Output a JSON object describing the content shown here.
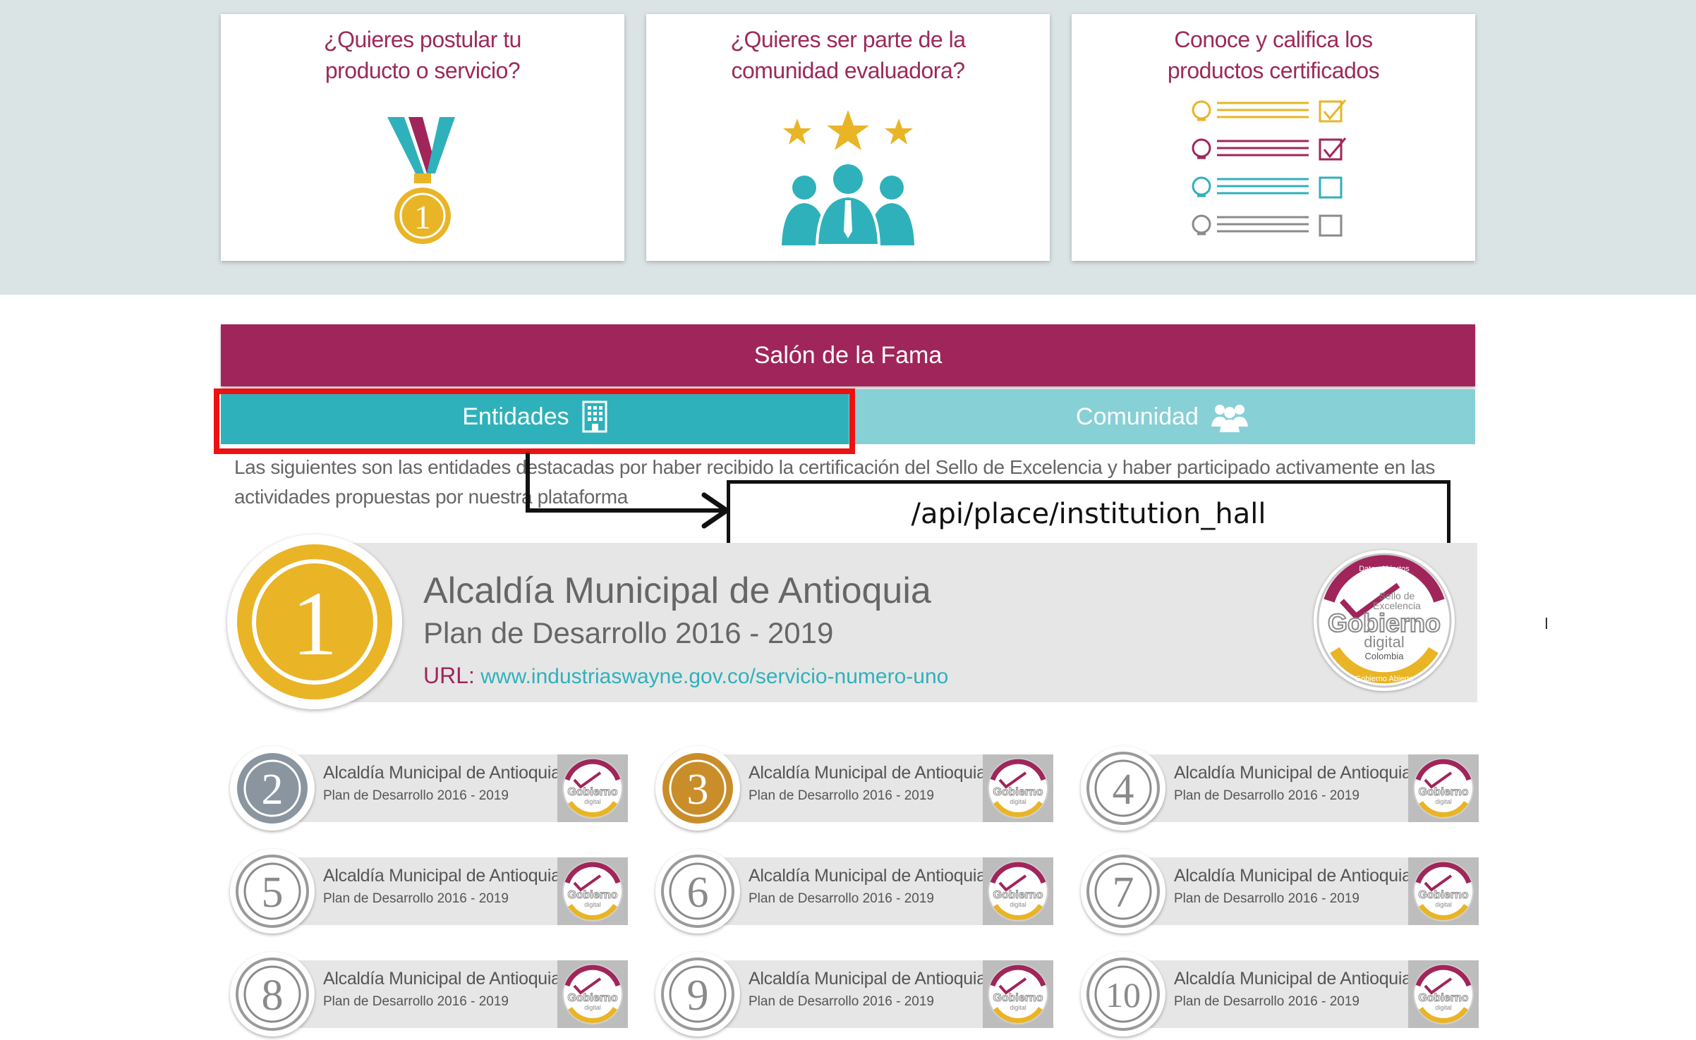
{
  "promo_cards": [
    {
      "title": "¿Quieres postular tu\nproducto o servicio?",
      "icon": "medal-icon"
    },
    {
      "title": "¿Quieres ser parte de la\ncomunidad evaluadora?",
      "icon": "community-stars-icon"
    },
    {
      "title": "Conoce y califica los\nproductos certificados",
      "icon": "checklist-icon"
    }
  ],
  "hall": {
    "title": "Salón de la Fama",
    "tabs": [
      {
        "label": "Entidades",
        "icon": "building-icon",
        "active": true
      },
      {
        "label": "Comunidad",
        "icon": "group-icon",
        "active": false
      }
    ],
    "intro": "Las siguientes son las entidades destacadas por haber recibido la certificación del Sello de Excelencia y haber participado activamente en las actividades propuestas por nuestra plataforma"
  },
  "annotation": {
    "endpoint": "/api/place/institution_hall"
  },
  "winner": {
    "rank": "1",
    "name": "Alcaldía Municipal de Antioquia",
    "plan": "Plan de Desarrollo 2016 - 2019",
    "url_label": "URL:",
    "url": "www.industriaswayne.gov.co/servicio-numero-uno",
    "seal": {
      "top": "Datos Abiertos",
      "line1": "Sello de",
      "line2": "Excelencia",
      "brand": "Gobierno",
      "sub": "digital",
      "country": "Colombia",
      "bottom": "Gobierno Abierto"
    }
  },
  "ranking": [
    {
      "rank": "2",
      "name": "Alcaldía Municipal de Antioquia",
      "plan": "Plan de Desarrollo 2016 - 2019",
      "medal_color": "#8a95a0"
    },
    {
      "rank": "3",
      "name": "Alcaldía Municipal de Antioquia",
      "plan": "Plan de Desarrollo 2016 - 2019",
      "medal_color": "#c98d2a"
    },
    {
      "rank": "4",
      "name": "Alcaldía Municipal de Antioquia",
      "plan": "Plan de Desarrollo 2016 - 2019",
      "medal_color": "#ffffff"
    },
    {
      "rank": "5",
      "name": "Alcaldía Municipal de Antioquia",
      "plan": "Plan de Desarrollo 2016 - 2019",
      "medal_color": "#ffffff"
    },
    {
      "rank": "6",
      "name": "Alcaldía Municipal de Antioquia",
      "plan": "Plan de Desarrollo 2016 - 2019",
      "medal_color": "#ffffff"
    },
    {
      "rank": "7",
      "name": "Alcaldía Municipal de Antioquia",
      "plan": "Plan de Desarrollo 2016 - 2019",
      "medal_color": "#ffffff"
    },
    {
      "rank": "8",
      "name": "Alcaldía Municipal de Antioquia",
      "plan": "Plan de Desarrollo 2016 - 2019",
      "medal_color": "#ffffff"
    },
    {
      "rank": "9",
      "name": "Alcaldía Municipal de Antioquia",
      "plan": "Plan de Desarrollo 2016 - 2019",
      "medal_color": "#ffffff"
    },
    {
      "rank": "10",
      "name": "Alcaldía Municipal de Antioquia",
      "plan": "Plan de Desarrollo 2016 - 2019",
      "medal_color": "#ffffff"
    }
  ],
  "colors": {
    "brand_magenta": "#a0255a",
    "teal": "#2fb1bb",
    "teal_light": "#87d0d6",
    "gold": "#e9b425",
    "highlight_red": "#ee1111"
  }
}
